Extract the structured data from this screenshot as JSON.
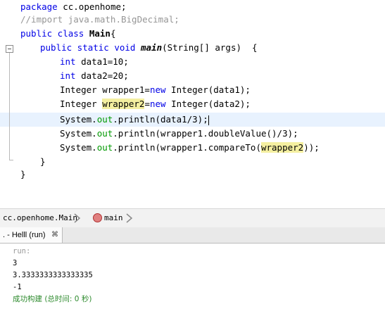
{
  "editor": {
    "package_kw": "package",
    "package_name": " cc.openhome;",
    "comment": "//import java.math.BigDecimal;",
    "class_kw": "public class ",
    "class_name": "Main",
    "class_brace": "{",
    "main_kw": "public static void ",
    "main_name": "main",
    "main_args": "(String[] args)  {",
    "l4_kw": "int",
    "l4_rest": " data1=10;",
    "l5_kw": "int",
    "l5_rest": " data2=20;",
    "l6_pre": "Integer wrapper1=",
    "l6_kw": "new",
    "l6_post": " Integer(data1);",
    "l7_pre": "Integer ",
    "l7_hl": "wrapper2",
    "l7_mid": "=",
    "l7_kw": "new",
    "l7_post": " Integer(data2);",
    "l8_pre": "System.",
    "l8_fld": "out",
    "l8_post": ".println(data1/3);",
    "l9_pre": "System.",
    "l9_fld": "out",
    "l9_post": ".println(wrapper1.doubleValue()/3);",
    "l10_pre": "System.",
    "l10_fld": "out",
    "l10_mid": ".println(wrapper1.compareTo(",
    "l10_hl": "wrapper2",
    "l10_post": "));",
    "close_method": "}",
    "close_class": "}"
  },
  "breadcrumb": {
    "class_path": "cc.openhome.Main",
    "method": "main"
  },
  "output_panel": {
    "tab_label": ". - Helll (run)",
    "close_glyph": "⌘",
    "lines": {
      "run": "run:",
      "l1": "3",
      "l2": "3.3333333333333335",
      "l3": "-1",
      "build": "成功构建 (总时间: 0 秒)"
    }
  },
  "colors": {
    "keyword": "#0000e6",
    "comment": "#969696",
    "field": "#009900",
    "highlight": "#f4efa0",
    "current_line": "#e8f2fe",
    "build_success": "#2e8b2e"
  }
}
